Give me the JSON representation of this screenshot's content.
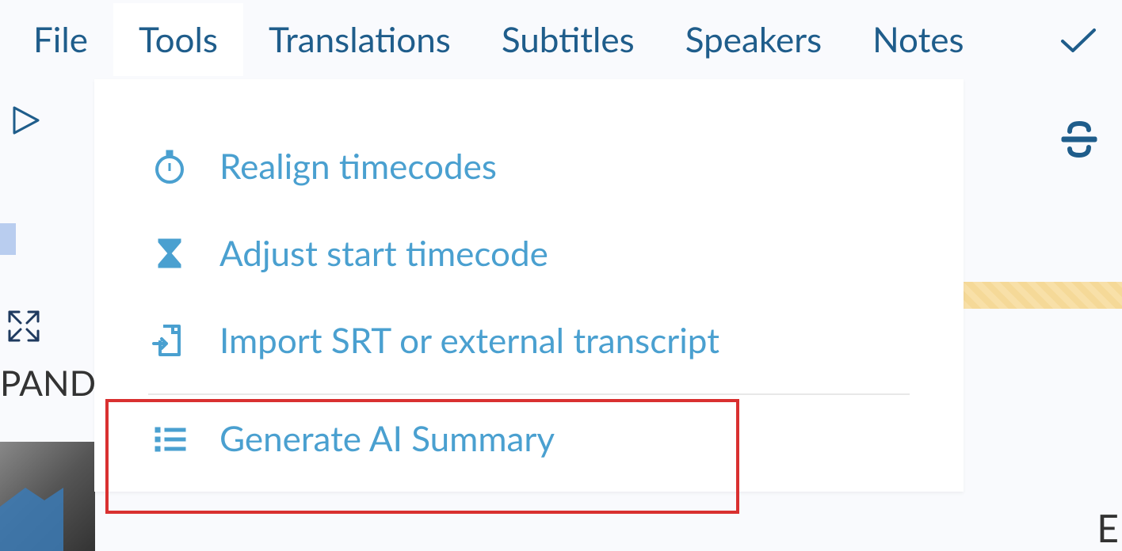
{
  "menubar": {
    "items": [
      {
        "label": "File"
      },
      {
        "label": "Tools"
      },
      {
        "label": "Translations"
      },
      {
        "label": "Subtitles"
      },
      {
        "label": "Speakers"
      },
      {
        "label": "Notes"
      }
    ]
  },
  "dropdown": {
    "items": [
      {
        "label": "Realign timecodes"
      },
      {
        "label": "Adjust start timecode"
      },
      {
        "label": "Import SRT or external transcript"
      },
      {
        "label": "Generate AI Summary"
      }
    ]
  },
  "side": {
    "pand_text": "PAND"
  },
  "partial": {
    "right_char": "E"
  }
}
